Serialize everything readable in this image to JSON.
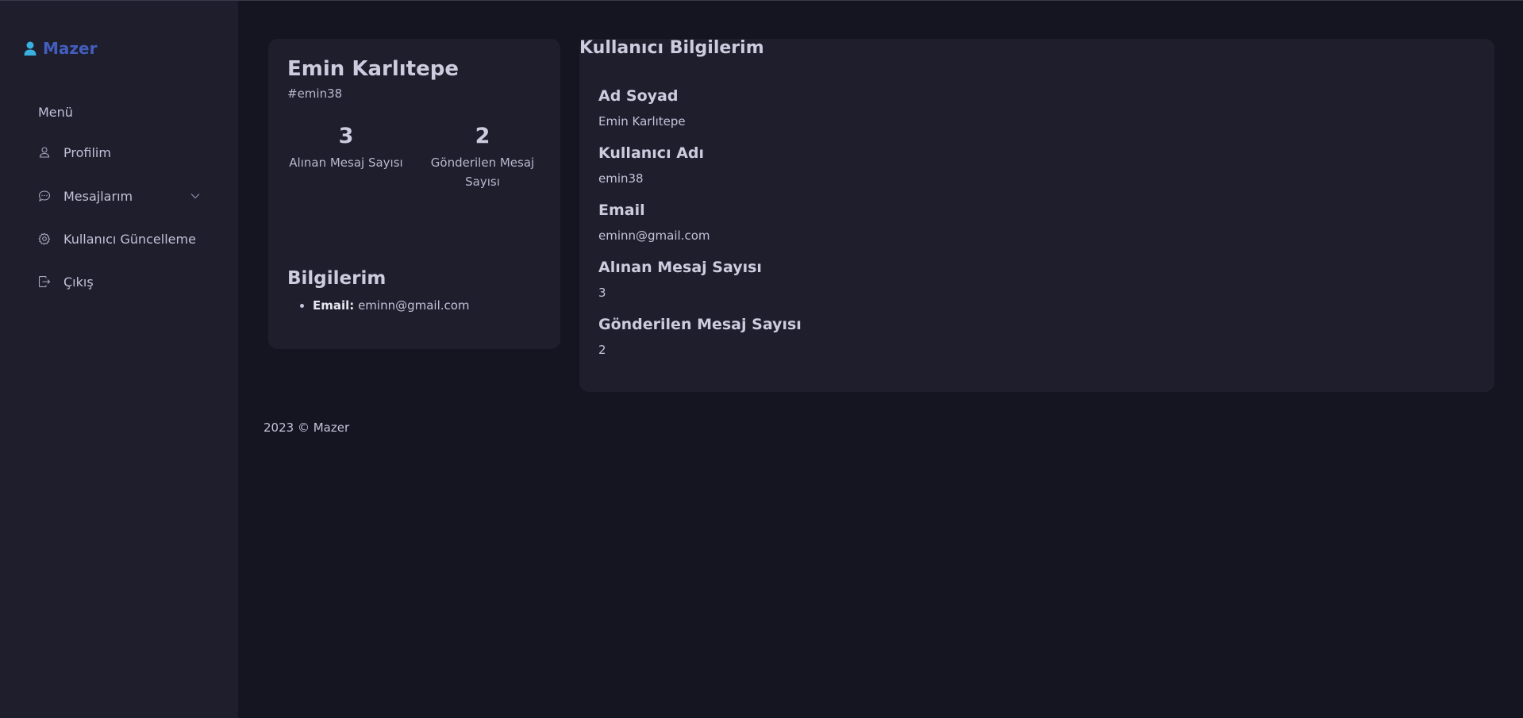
{
  "sidebar": {
    "brand": "Mazer",
    "menu_title": "Menü",
    "items": [
      {
        "label": "Profilim",
        "icon": "person-icon"
      },
      {
        "label": "Mesajlarım",
        "icon": "chat-icon"
      },
      {
        "label": "Kullanıcı Güncelleme",
        "icon": "gear-icon"
      },
      {
        "label": "Çıkış",
        "icon": "logout-icon"
      }
    ]
  },
  "profile": {
    "name": "Emin Karlıtepe",
    "handle": "#emin38",
    "stats": [
      {
        "value": "3",
        "label": "Alınan Mesaj Sayısı"
      },
      {
        "value": "2",
        "label": "Gönderilen Mesaj Sayısı"
      }
    ],
    "info_title": "Bilgilerim",
    "email_label": "Email:",
    "email": "eminn@gmail.com"
  },
  "details": {
    "title": "Kullanıcı Bilgilerim",
    "fields": [
      {
        "label": "Ad Soyad",
        "value": "Emin Karlıtepe"
      },
      {
        "label": "Kullanıcı Adı",
        "value": "emin38"
      },
      {
        "label": "Email",
        "value": "eminn@gmail.com"
      },
      {
        "label": "Alınan Mesaj Sayısı",
        "value": "3"
      },
      {
        "label": "Gönderilen Mesaj Sayısı",
        "value": "2"
      }
    ]
  },
  "footer": {
    "text": "2023 © Mazer"
  },
  "colors": {
    "accent": "#435ebe",
    "brand_icon": "#3ab0e0",
    "background": "#151521",
    "panel": "#1e1e2d"
  }
}
